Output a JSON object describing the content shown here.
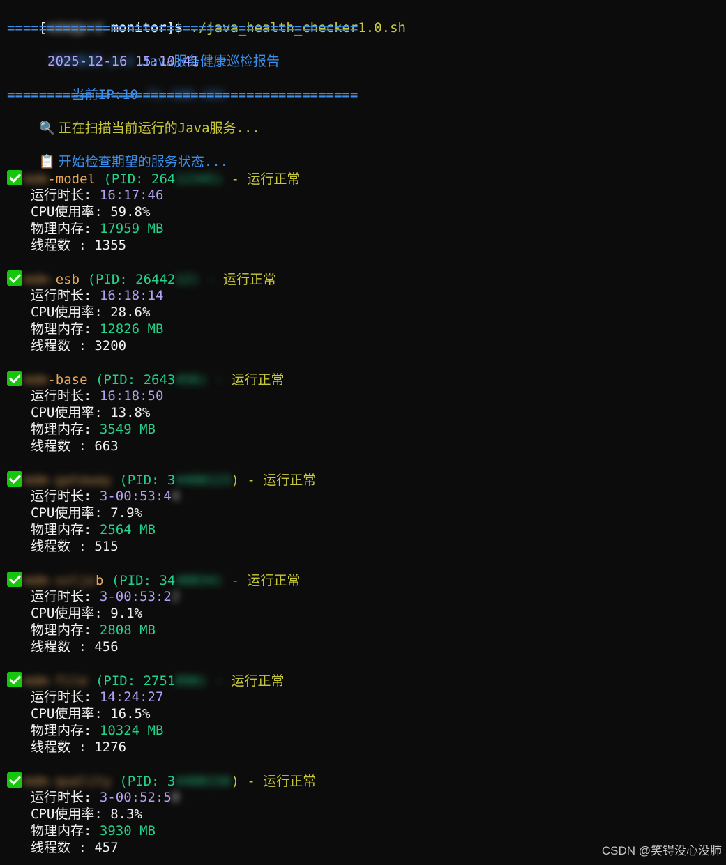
{
  "prompt": {
    "open_bracket": "[",
    "user_host_blurred": "mdm@prd",
    "dir": " monitor]$ ",
    "command": "./java_health_checker1.0.sh"
  },
  "separator": "============================================",
  "header": {
    "env_blurred": "MDM系统-prd",
    "title": " Java服务健康巡检报告",
    "datetime": "2025-12-16 15:10:41",
    "ip_label": "当前IP:",
    "ip_visible": "10",
    "ip_blurred": ".71.100.101"
  },
  "scan_icon": "🔍",
  "scan_msg": "正在扫描当前运行的Java服务...",
  "check_icon": "📋",
  "check_msg": "开始检查期望的服务状态...",
  "labels": {
    "uptime": "运行时长: ",
    "cpu": "CPU使用率: ",
    "mem": "物理内存: ",
    "threads": "线程数 : "
  },
  "status_text": "运行正常",
  "services": [
    {
      "name_hidden": "mdm",
      "name_visible": "-model",
      "pid_prefix": " (PID: 264",
      "pid_hidden": "12345)",
      "suffix": " - ",
      "uptime": "16:17:46",
      "cpu": "59.8%",
      "mem": "17959 MB",
      "threads": "1355"
    },
    {
      "name_hidden": "mdm-",
      "name_visible": "esb",
      "pid_prefix": " (PID: 26442",
      "pid_hidden": "12) - ",
      "suffix": "",
      "uptime": "16:18:14",
      "cpu": "28.6%",
      "mem": "12826 MB",
      "threads": "3200"
    },
    {
      "name_hidden": "mdm",
      "name_visible": "-base",
      "pid_prefix": " (PID: 2643",
      "pid_hidden": "456) - ",
      "suffix": "",
      "uptime": "16:18:50",
      "cpu": "13.8%",
      "mem": "3549 MB",
      "threads": "663"
    },
    {
      "name_hidden": "mdm-gateway",
      "name_visible": "",
      "pid_prefix": " (PID: 3",
      "pid_hidden": "4400123",
      "suffix": ") - ",
      "uptime": "3-00:53:4",
      "uptime_hidden": "4",
      "cpu": "7.9%",
      "mem": "2564 MB",
      "threads": "515"
    },
    {
      "name_hidden": "mdm-xxljo",
      "name_visible": "b",
      "pid_prefix": " (PID: 34",
      "pid_hidden": "40034)",
      "suffix": " - ",
      "uptime": "3-00:53:2",
      "uptime_hidden": "2",
      "cpu": "9.1%",
      "mem": "2808 MB",
      "threads": "456"
    },
    {
      "name_hidden": "mdm-file",
      "name_visible": "",
      "pid_prefix": " (PID: 2751",
      "pid_hidden": "890) - ",
      "suffix": "",
      "uptime": "14:24:27",
      "cpu": "16.5%",
      "mem": "10324 MB",
      "threads": "1276"
    },
    {
      "name_hidden": "mdm-quality",
      "name_visible": "",
      "pid_prefix": " (PID: 3",
      "pid_hidden": "4400156",
      "suffix": ") - ",
      "uptime": "3-00:52:5",
      "uptime_hidden": "0",
      "cpu": "8.3%",
      "mem": "3930 MB",
      "threads": "457"
    }
  ],
  "watermark": "CSDN @笑锝没心没肺"
}
